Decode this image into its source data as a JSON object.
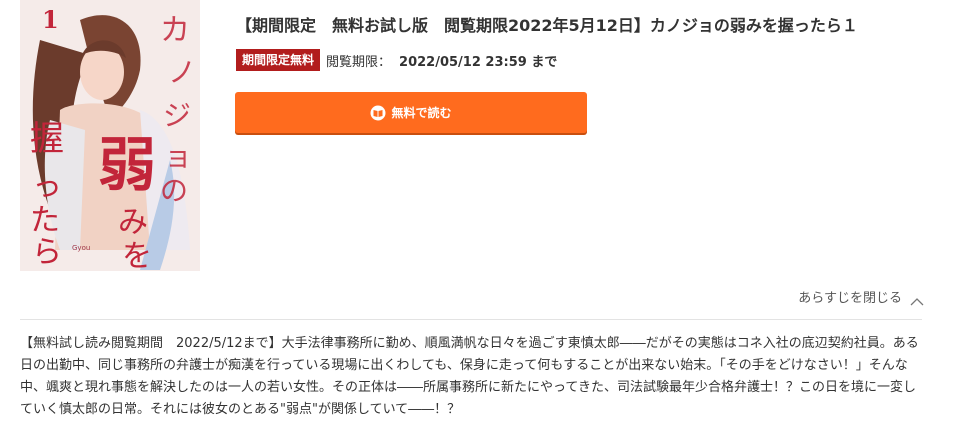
{
  "product": {
    "title": "【期間限定　無料お試し版　閲覧期限2022年5月12日】カノジョの弱みを握ったら１",
    "cover": {
      "volume_number": "1",
      "title_text": "カノジョの弱みを握ったら",
      "author": "Gyou"
    }
  },
  "campaign": {
    "badge": "期間限定無料",
    "period_label": "閲覧期限：",
    "period_value": "2022/05/12 23:59 まで"
  },
  "actions": {
    "read_free_label": "無料で読む",
    "read_free_icon": "read-book-icon",
    "button_color": "#ff6b1e"
  },
  "synopsis": {
    "toggle_label": "あらすじを閉じる",
    "toggle_icon": "chevron-up-icon",
    "text": "【無料試し読み閲覧期間　2022/5/12まで】大手法律事務所に勤め、順風満帆な日々を過ごす東慎太郎――だがその実態はコネ入社の底辺契約社員。ある日の出勤中、同じ事務所の弁護士が痴漢を行っている現場に出くわしても、保身に走って何もすることが出来ない始末。「その手をどけなさい！」そんな中、颯爽と現れ事態を解決したのは一人の若い女性。その正体は――所属事務所に新たにやってきた、司法試験最年少合格弁護士！？この日を境に一変していく慎太郎の日常。それには彼女のとある\"弱点\"が関係していて――！？"
  }
}
